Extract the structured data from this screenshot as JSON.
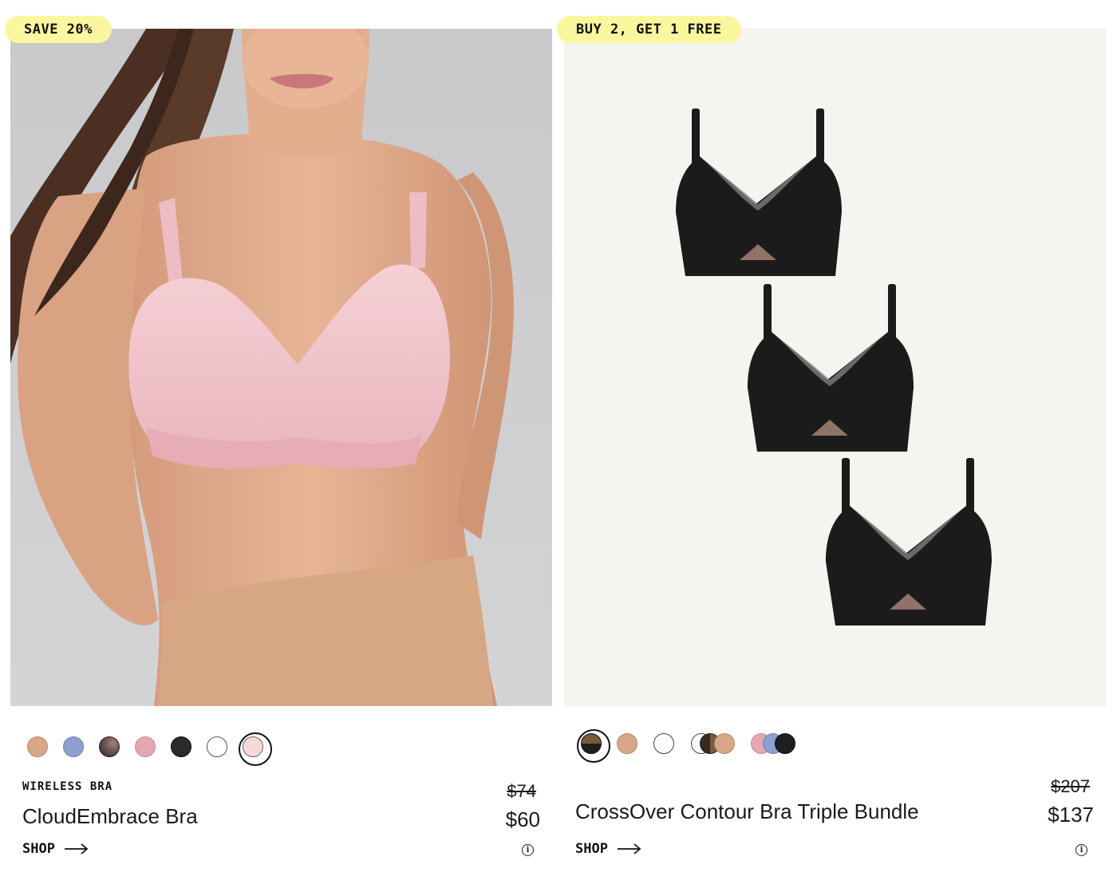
{
  "products": [
    {
      "badge": "SAVE 20%",
      "category": "WIRELESS BRA",
      "name": "CloudEmbrace Bra",
      "price_original": "$74",
      "price_sale": "$60",
      "cta": "SHOP",
      "swatches": [
        {
          "color": "#d6a888"
        },
        {
          "color": "#8d9fcf"
        },
        {
          "color": "#5a4040"
        },
        {
          "color": "#e4a8b2"
        },
        {
          "color": "#2a2a2a"
        },
        {
          "color": "#ffffff"
        },
        {
          "color": "#f5d9d6",
          "selected": true
        }
      ]
    },
    {
      "badge": "BUY 2, GET 1 FREE",
      "category": "",
      "name": "CrossOver Contour Bra Triple Bundle",
      "price_original": "$207",
      "price_sale": "$137",
      "cta": "SHOP",
      "swatches": [
        {
          "colors": [
            "#7a5a3a",
            "#1e1e1e"
          ],
          "selected": true
        },
        {
          "colors": [
            "#d6a888"
          ]
        },
        {
          "colors": [
            "#ffffff"
          ]
        },
        {
          "colors": [
            "#ffffff",
            "#3a2a20",
            "#d6a888"
          ]
        },
        {
          "colors": [
            "#e4a8b2",
            "#8d9fcf",
            "#1e1e1e"
          ]
        }
      ]
    }
  ],
  "colors": {
    "badge_bg": "#fbf79e",
    "left_image_bg": "#cfcfd1",
    "right_image_bg": "#f4f4f0",
    "skin": "#e2ae8f",
    "bra_pink": "#f0c6cc",
    "bra_black": "#1b1b1b"
  }
}
